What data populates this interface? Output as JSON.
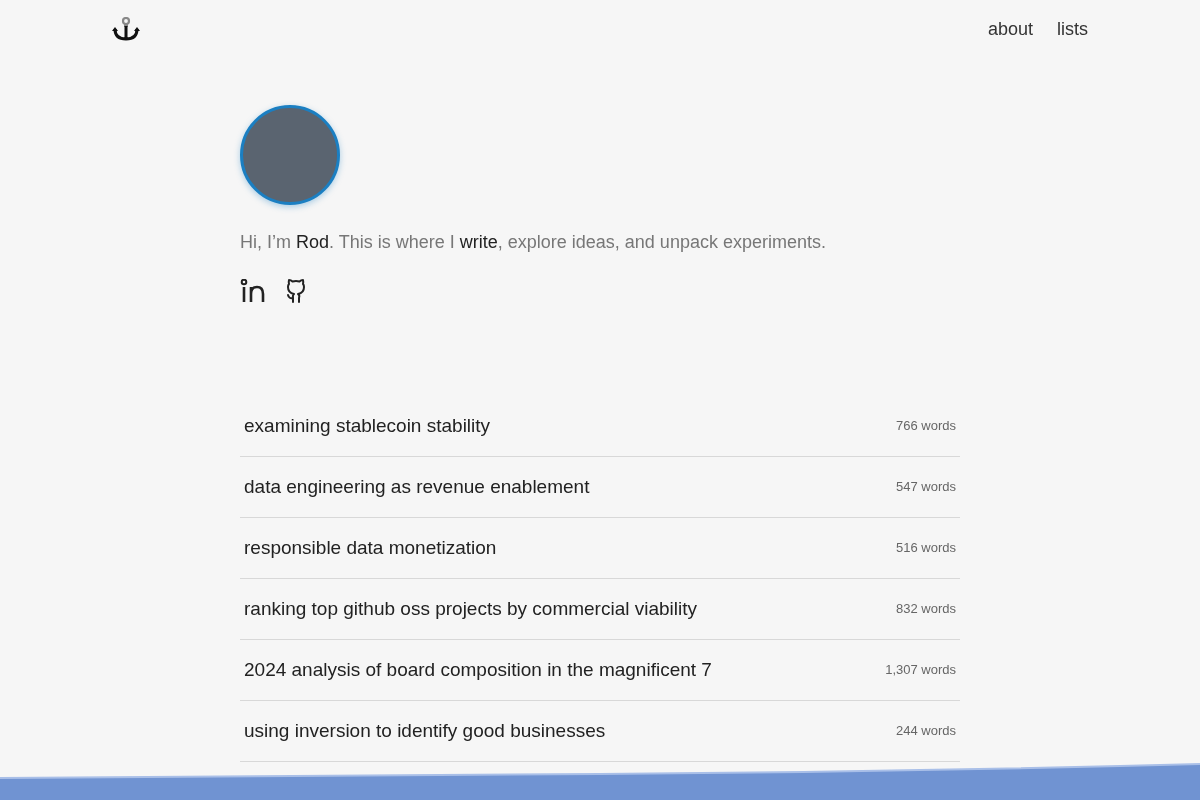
{
  "nav": [
    "about",
    "lists"
  ],
  "intro": [
    {
      "kind": "text",
      "text": "Hi, I’m "
    },
    {
      "kind": "link",
      "text": "Rod"
    },
    {
      "kind": "text",
      "text": ". This is where I "
    },
    {
      "kind": "link",
      "text": "write"
    },
    {
      "kind": "text",
      "text": ", explore ideas, and unpack experiments."
    }
  ],
  "posts": [
    {
      "title": "examining stablecoin stability",
      "words": "766 words"
    },
    {
      "title": "data engineering as revenue enablement",
      "words": "547 words"
    },
    {
      "title": "responsible data monetization",
      "words": "516 words"
    },
    {
      "title": "ranking top github oss projects by commercial viability",
      "words": "832 words"
    },
    {
      "title": "2024 analysis of board composition in the magnificent 7",
      "words": "1,307 words"
    },
    {
      "title": "using inversion to identify good businesses",
      "words": "244 words"
    }
  ]
}
